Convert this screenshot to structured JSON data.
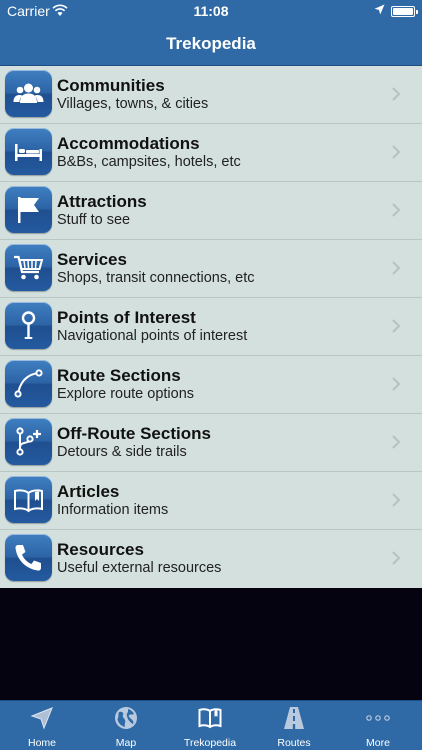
{
  "status_bar": {
    "carrier": "Carrier",
    "time": "11:08"
  },
  "nav": {
    "title": "Trekopedia"
  },
  "list": [
    {
      "title": "Communities",
      "subtitle": "Villages, towns, & cities",
      "icon": "people-icon"
    },
    {
      "title": "Accommodations",
      "subtitle": "B&Bs, campsites, hotels, etc",
      "icon": "bed-icon"
    },
    {
      "title": "Attractions",
      "subtitle": "Stuff to see",
      "icon": "flag-icon"
    },
    {
      "title": "Services",
      "subtitle": "Shops, transit connections, etc",
      "icon": "cart-icon"
    },
    {
      "title": "Points of Interest",
      "subtitle": "Navigational points of interest",
      "icon": "pin-icon"
    },
    {
      "title": "Route Sections",
      "subtitle": "Explore route options",
      "icon": "route-curve-icon"
    },
    {
      "title": "Off-Route Sections",
      "subtitle": "Detours & side trails",
      "icon": "branch-icon"
    },
    {
      "title": "Articles",
      "subtitle": "Information items",
      "icon": "book-icon"
    },
    {
      "title": "Resources",
      "subtitle": "Useful external resources",
      "icon": "phone-icon"
    }
  ],
  "tabs": [
    {
      "label": "Home",
      "icon": "navigation-arrow-icon"
    },
    {
      "label": "Map",
      "icon": "globe-icon"
    },
    {
      "label": "Trekopedia",
      "icon": "book-icon",
      "selected": true
    },
    {
      "label": "Routes",
      "icon": "road-icon"
    },
    {
      "label": "More",
      "icon": "more-dots-icon"
    }
  ],
  "colors": {
    "bar": "#2f6aa6",
    "list_bg": "#d3e0dd",
    "tab_selected": "#ffffff",
    "tab_unselected": "#c9d6e6"
  }
}
